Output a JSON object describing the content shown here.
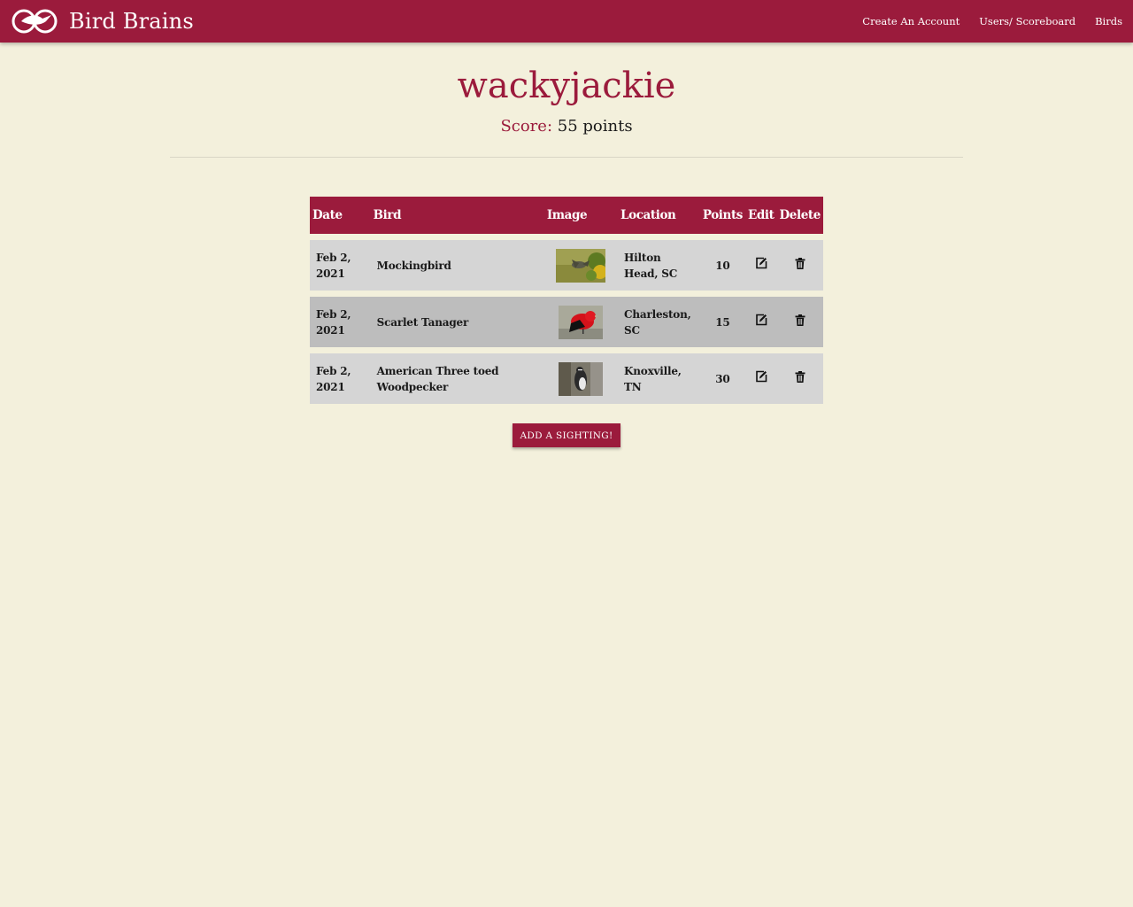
{
  "nav": {
    "brand": "Bird Brains",
    "links": [
      "Create An Account",
      "Users/ Scoreboard",
      "Birds"
    ]
  },
  "profile": {
    "username": "wackyjackie",
    "score_label": "Score:",
    "score_value": "55 points"
  },
  "table": {
    "headers": [
      "Date",
      "Bird",
      "Image",
      "Location",
      "Points",
      "Edit",
      "Delete"
    ],
    "rows": [
      {
        "date": "Feb 2, 2021",
        "bird": "Mockingbird",
        "location": "Hilton Head, SC",
        "points": "10"
      },
      {
        "date": "Feb 2, 2021",
        "bird": "Scarlet Tanager",
        "location": "Charleston, SC",
        "points": "15"
      },
      {
        "date": "Feb 2, 2021",
        "bird": "American Three toed Woodpecker",
        "location": "Knoxville, TN",
        "points": "30"
      }
    ]
  },
  "actions": {
    "add_button": "ADD A SIGHTING!"
  },
  "colors": {
    "primary": "#9b1b3c",
    "background": "#f3f0dc",
    "row_light": "#d5d5d5",
    "row_dark": "#bdbdbd"
  },
  "icons": {
    "logo": "bird-logo-icon",
    "edit": "edit-icon",
    "delete": "trash-icon"
  }
}
